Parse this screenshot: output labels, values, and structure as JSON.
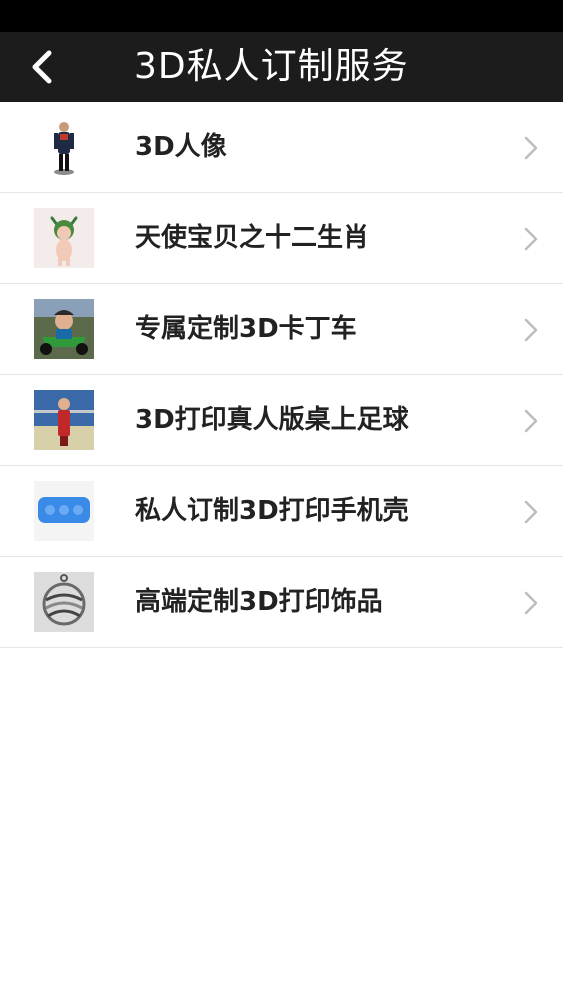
{
  "header": {
    "title": "3D私人订制服务",
    "back_icon": "chevron-left-icon"
  },
  "colors": {
    "status_bar": "#000000",
    "header_bg": "#1c1c1c",
    "header_text": "#ffffff",
    "item_text": "#222222",
    "divider": "#e6e6e6",
    "chevron": "#bdbdbd"
  },
  "list": {
    "items": [
      {
        "label": "3D人像",
        "icon": "figurine-thumbnail"
      },
      {
        "label": "天使宝贝之十二生肖",
        "icon": "baby-figure-thumbnail"
      },
      {
        "label": "专属定制3D卡丁车",
        "icon": "go-kart-thumbnail"
      },
      {
        "label": "3D打印真人版桌上足球",
        "icon": "foosball-thumbnail"
      },
      {
        "label": "私人订制3D打印手机壳",
        "icon": "phone-case-thumbnail"
      },
      {
        "label": "高端定制3D打印饰品",
        "icon": "pendant-thumbnail"
      }
    ]
  }
}
